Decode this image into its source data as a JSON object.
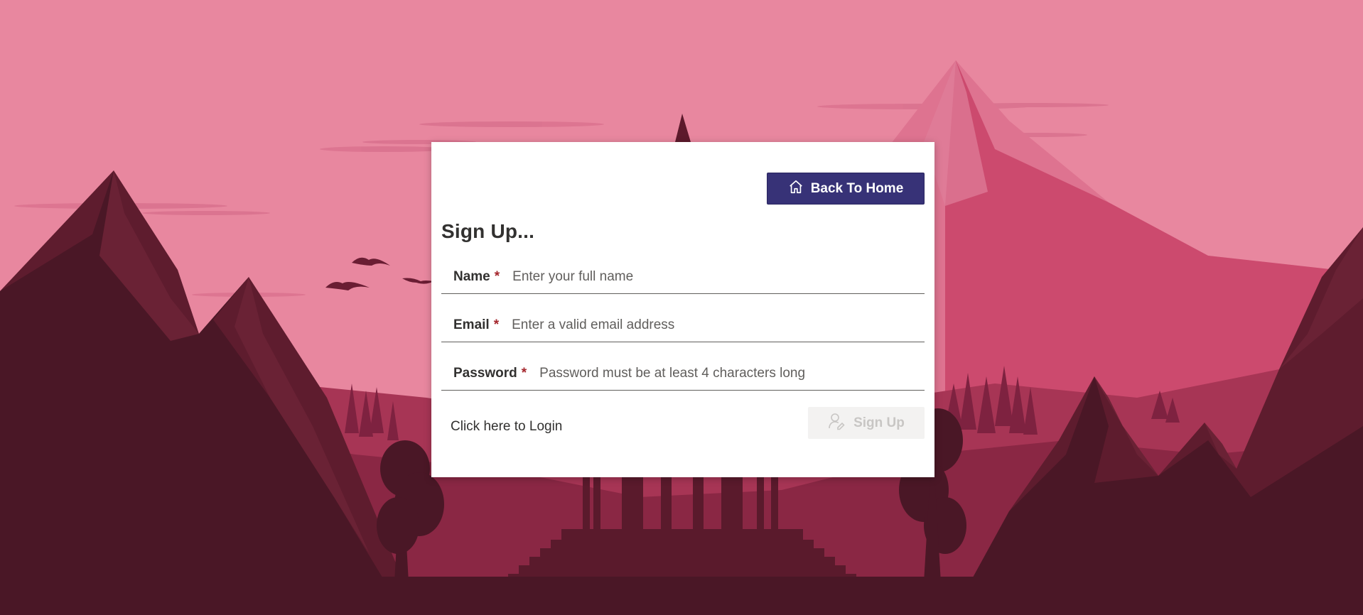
{
  "header": {
    "back_label": "Back To Home",
    "back_icon": "home-icon"
  },
  "form": {
    "title": "Sign Up...",
    "fields": [
      {
        "label": "Name",
        "required_mark": "*",
        "placeholder": "Enter your full name",
        "value": ""
      },
      {
        "label": "Email",
        "required_mark": "*",
        "placeholder": "Enter a valid email address",
        "value": ""
      },
      {
        "label": "Password",
        "required_mark": "*",
        "placeholder": "Password must be at least 4 characters long",
        "value": ""
      }
    ],
    "login_link": "Click here to Login",
    "submit_label": "Sign Up",
    "submit_icon": "add-user-icon",
    "submit_enabled": false
  },
  "colors": {
    "sky": "#e8879f",
    "brand_button": "#373277",
    "required": "#a4262c",
    "disabled_bg": "#f3f2f1",
    "disabled_text": "#c8c6c4"
  }
}
